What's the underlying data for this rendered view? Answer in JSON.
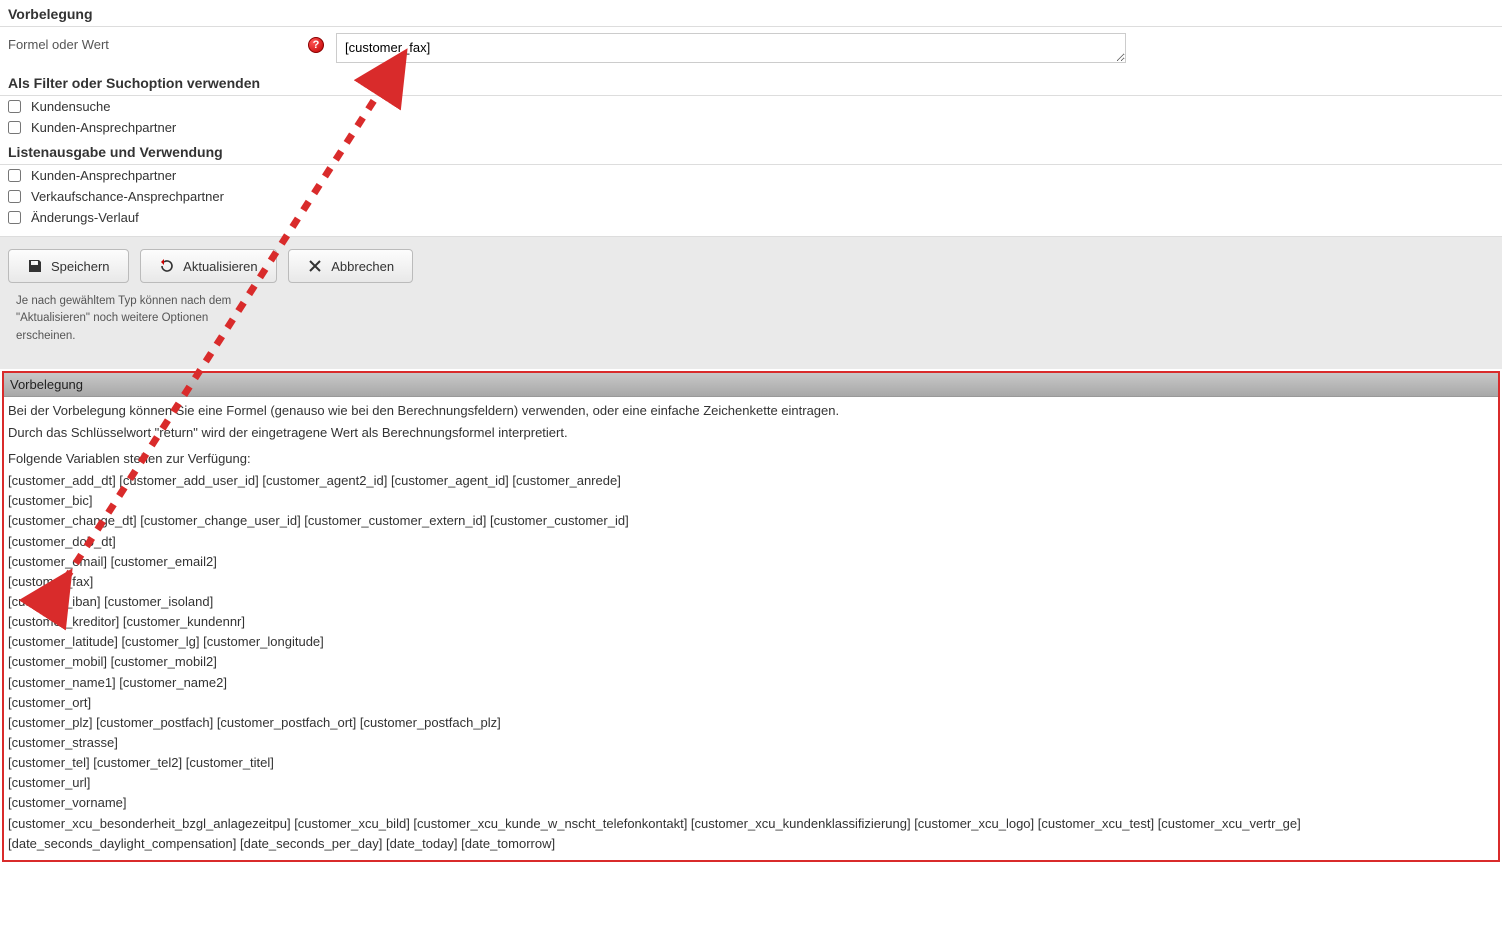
{
  "sections": {
    "vorbelegung_title": "Vorbelegung",
    "formula_label": "Formel oder Wert",
    "formula_value": "[customer_fax]",
    "filter_title": "Als Filter oder Suchoption verwenden",
    "filter_options": {
      "kundensuche": "Kundensuche",
      "kunden_ansprechpartner": "Kunden-Ansprechpartner"
    },
    "output_title": "Listenausgabe und Verwendung",
    "output_options": {
      "kunden_ansprechpartner": "Kunden-Ansprechpartner",
      "verkaufschance_ansprechpartner": "Verkaufschance-Ansprechpartner",
      "aenderungs_verlauf": "Änderungs-Verlauf"
    }
  },
  "buttons": {
    "save": "Speichern",
    "refresh": "Aktualisieren",
    "cancel": "Abbrechen"
  },
  "hint": "Je nach gewähltem Typ können nach dem \"Aktualisieren\" noch weitere Optionen erscheinen.",
  "help_panel": {
    "title": "Vorbelegung",
    "intro1": "Bei der Vorbelegung können Sie eine Formel (genauso wie bei den Berechnungsfeldern) verwenden, oder eine einfache Zeichenkette eintragen.",
    "intro2": "Durch das Schlüsselwort \"return\" wird der eingetragene Wert als Berechnungsformel interpretiert.",
    "vars_label": "Folgende Variablen stehen zur Verfügung:",
    "var_lines": [
      "[customer_add_dt] [customer_add_user_id] [customer_agent2_id] [customer_agent_id] [customer_anrede]",
      "[customer_bic]",
      "[customer_change_dt] [customer_change_user_id] [customer_customer_extern_id] [customer_customer_id]",
      "[customer_dob_dt]",
      "[customer_email] [customer_email2]",
      "[customer_fax]",
      "[customer_iban] [customer_isoland]",
      "[customer_kreditor] [customer_kundennr]",
      "[customer_latitude] [customer_lg] [customer_longitude]",
      "[customer_mobil] [customer_mobil2]",
      "[customer_name1] [customer_name2]",
      "[customer_ort]",
      "[customer_plz] [customer_postfach] [customer_postfach_ort] [customer_postfach_plz]",
      "[customer_strasse]",
      "[customer_tel] [customer_tel2] [customer_titel]",
      "[customer_url]",
      "[customer_vorname]",
      "[customer_xcu_besonderheit_bzgl_anlagezeitpu] [customer_xcu_bild] [customer_xcu_kunde_w_nscht_telefonkontakt] [customer_xcu_kundenklassifizierung] [customer_xcu_logo] [customer_xcu_test] [customer_xcu_vertr_ge]",
      "[date_seconds_daylight_compensation] [date_seconds_per_day] [date_today] [date_tomorrow]"
    ]
  }
}
